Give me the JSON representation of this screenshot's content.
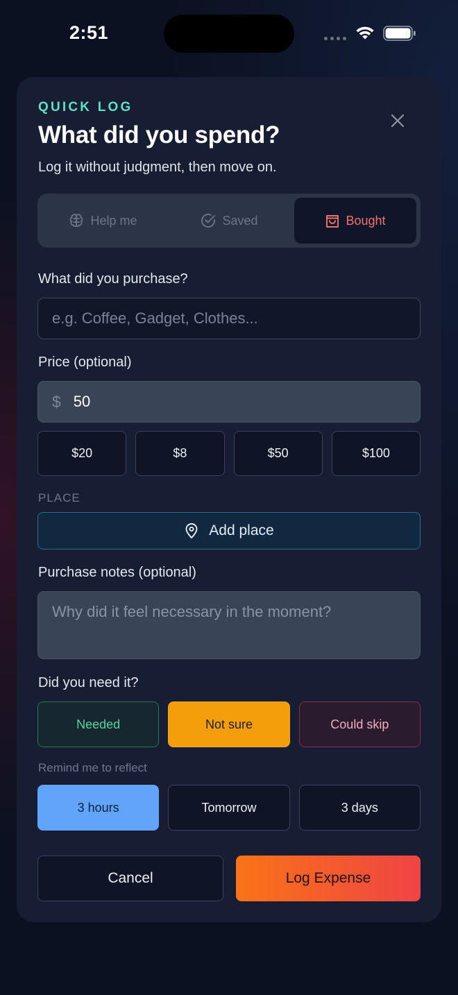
{
  "status_bar": {
    "time": "2:51"
  },
  "modal": {
    "eyebrow": "QUICK LOG",
    "title": "What did you spend?",
    "subtitle": "Log it without judgment, then move on."
  },
  "segments": [
    {
      "label": "Help me",
      "icon": "brain-icon",
      "selected": false
    },
    {
      "label": "Saved",
      "icon": "check-circle-icon",
      "selected": false
    },
    {
      "label": "Bought",
      "icon": "shopping-bag-icon",
      "selected": true
    }
  ],
  "purchase": {
    "label": "What did you purchase?",
    "placeholder": "e.g. Coffee, Gadget, Clothes..."
  },
  "price": {
    "label": "Price (optional)",
    "currency": "$",
    "value": "50",
    "presets": [
      "$20",
      "$8",
      "$50",
      "$100"
    ]
  },
  "place": {
    "label": "PLACE",
    "button": "Add place"
  },
  "notes": {
    "label": "Purchase notes (optional)",
    "placeholder": "Why did it feel necessary in the moment?"
  },
  "need": {
    "label": "Did you need it?",
    "options": [
      "Needed",
      "Not sure",
      "Could skip"
    ],
    "selected": "Not sure"
  },
  "remind": {
    "label": "Remind me to reflect",
    "options": [
      "3 hours",
      "Tomorrow",
      "3 days"
    ],
    "selected": "3 hours"
  },
  "actions": {
    "cancel": "Cancel",
    "submit": "Log Expense"
  },
  "colors": {
    "accent_teal": "#5ee1c8",
    "bought_red": "#f0726d",
    "not_sure_amber": "#f59e0b",
    "reminder_blue": "#60a5fa",
    "cta_gradient_start": "#f97316",
    "cta_gradient_end": "#ef4444"
  }
}
